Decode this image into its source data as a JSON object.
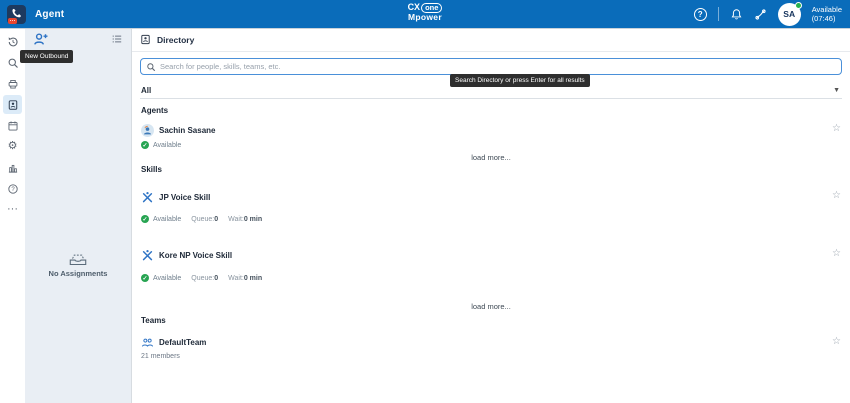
{
  "header": {
    "app_title": "Agent",
    "logo": {
      "cx": "CX",
      "one": "one",
      "mpower": "Mpower"
    },
    "user": {
      "initials": "SA",
      "status_line1": "Available",
      "status_line2": "(07:46)"
    }
  },
  "assignments": {
    "new_outbound_tooltip": "New Outbound",
    "empty_text": "No Assignments"
  },
  "directory": {
    "title": "Directory",
    "search_placeholder": "Search for people, skills, teams, etc.",
    "search_tooltip": "Search Directory or press Enter for all results",
    "filter_value": "All",
    "load_more": "load more...",
    "agents_heading": "Agents",
    "skills_heading": "Skills",
    "teams_heading": "Teams",
    "agents": [
      {
        "name": "Sachin Sasane",
        "status": "Available"
      }
    ],
    "skills": [
      {
        "name": "JP Voice Skill",
        "status": "Available",
        "queue_label": "Queue:",
        "queue_value": "0",
        "wait_label": "Wait:",
        "wait_value": "0 min"
      },
      {
        "name": "Kore NP Voice Skill",
        "status": "Available",
        "queue_label": "Queue:",
        "queue_value": "0",
        "wait_label": "Wait:",
        "wait_value": "0 min"
      }
    ],
    "teams": [
      {
        "name": "DefaultTeam",
        "members": "21 members"
      }
    ]
  },
  "icons": {
    "star": "☆",
    "gear": "⚙",
    "more": "···",
    "chevron_down": "▼",
    "check": "✓",
    "question": "?"
  },
  "colors": {
    "header_blue": "#0a6cba",
    "accent_blue": "#2f74c5",
    "available_green": "#27a452",
    "search_border": "#4a90d9",
    "panel_bg": "#e9eef4",
    "tooltip_bg": "#2e2e2e"
  }
}
